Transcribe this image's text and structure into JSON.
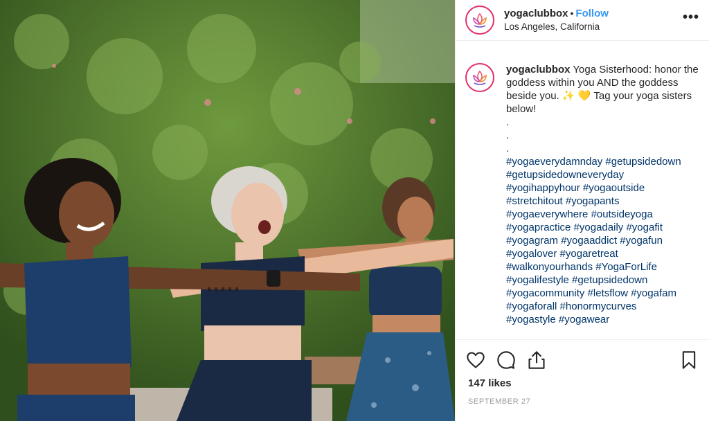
{
  "header": {
    "username": "yogaclubbox",
    "separator": "•",
    "follow_label": "Follow",
    "location": "Los Angeles, California",
    "more_label": "•••"
  },
  "caption": {
    "username": "yogaclubbox",
    "text_part1": "Yoga Sisterhood: honor the goddess within you AND the goddess beside you.",
    "emoji_sparkles": "✨",
    "emoji_heart": "💛",
    "text_part2": "Tag your yoga sisters below!",
    "dots": [
      ".",
      ".",
      "."
    ],
    "hashtag_lines": [
      "#yogaeverydamnday #getupsidedown",
      "#getupsidedowneveryday",
      "#yogihappyhour #yogaoutside",
      "#stretchitout #yogapants",
      "#yogaeverywhere #outsideyoga",
      "#yogapractice #yogadaily #yogafit",
      "#yogagram #yogaaddict #yogafun",
      "#yogalover #yogaretreat",
      "#walkonyourhands #YogaForLife",
      "#yogalifestyle #getupsidedown",
      "#yogacommunity #letsflow #yogafam",
      "#yogaforall #honormycurves",
      "#yogastyle #yogawear"
    ]
  },
  "actions": {
    "like_icon": "heart-icon",
    "comment_icon": "comment-icon",
    "share_icon": "share-icon",
    "save_icon": "bookmark-icon"
  },
  "likes": "147 likes",
  "date": "SEPTEMBER 27",
  "colors": {
    "follow": "#3897f0",
    "hashtag": "#003569",
    "text": "#262626",
    "muted": "#999999"
  }
}
